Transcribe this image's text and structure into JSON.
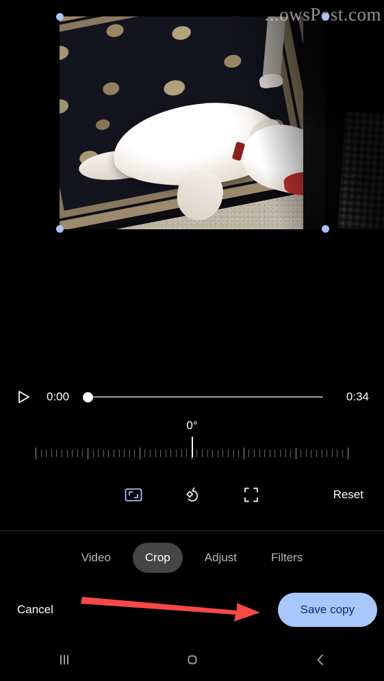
{
  "app": {
    "screen_title": "Crop"
  },
  "preview": {
    "watermark_text": "...owsPost.com",
    "crop_handles": [
      "top-left",
      "top-right",
      "bottom-left",
      "bottom-right"
    ]
  },
  "playback": {
    "play_icon": "play-triangle-icon",
    "current_time": "0:00",
    "total_time": "0:34",
    "progress_percent": 0
  },
  "rotation": {
    "value_label": "0°",
    "degrees": 0,
    "tick_count": 61
  },
  "tools": {
    "aspect_ratio": {
      "label": "Aspect ratio",
      "icon": "aspect-ratio-icon",
      "active": true,
      "color": "#a8c7fa"
    },
    "rotate": {
      "label": "Rotate",
      "icon": "rotate-left-icon",
      "active": false,
      "color": "#e3e3e3"
    },
    "perspective": {
      "label": "Perspective",
      "icon": "perspective-corners-icon",
      "active": false,
      "color": "#e3e3e3"
    },
    "reset_label": "Reset"
  },
  "tabs": [
    {
      "label": "Video",
      "active": false
    },
    {
      "label": "Crop",
      "active": true
    },
    {
      "label": "Adjust",
      "active": false
    },
    {
      "label": "Filters",
      "active": false
    }
  ],
  "actions": {
    "cancel_label": "Cancel",
    "save_label": "Save copy",
    "save_bg_color": "#a8c7fa",
    "save_text_color": "#062e6f"
  },
  "annotation": {
    "arrow_color": "#f74848",
    "points_to": "Save copy"
  },
  "navbar": {
    "recents_icon": "recents-bars-icon",
    "home_icon": "home-circle-icon",
    "back_icon": "back-chevron-icon"
  }
}
